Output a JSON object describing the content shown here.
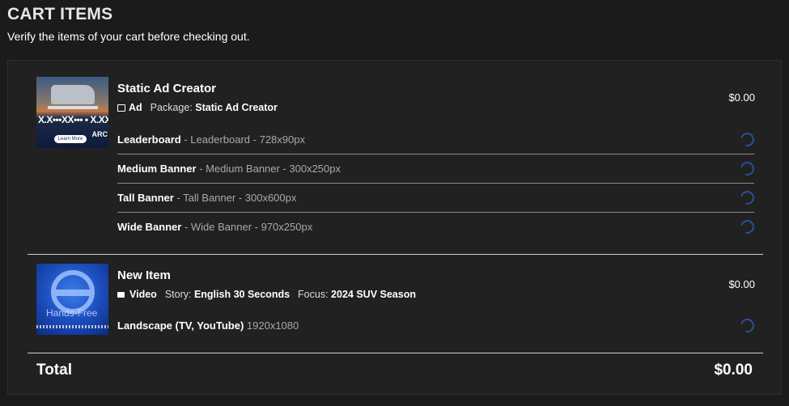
{
  "header": {
    "title": "CART ITEMS",
    "subtitle": "Verify the items of your cart before checking out."
  },
  "items": [
    {
      "icon": "static-ad-thumbnail",
      "title": "Static Ad Creator",
      "type": "Ad",
      "package_label": "Package:",
      "package_value": "Static Ad Creator",
      "price": "$0.00",
      "thumb_text": "X.X•••XX••• • X.XXX",
      "thumb_arc": "ARC",
      "thumb_button": "Learn More",
      "formats": [
        {
          "name": "Leaderboard",
          "desc": " - Leaderboard - 728x90px"
        },
        {
          "name": "Medium Banner",
          "desc": " - Medium Banner - 300x250px"
        },
        {
          "name": "Tall Banner",
          "desc": " - Tall Banner - 300x600px"
        },
        {
          "name": "Wide Banner",
          "desc": " - Wide Banner - 970x250px"
        }
      ]
    },
    {
      "icon": "video-thumbnail",
      "title": "New Item",
      "type": "Video",
      "story_label": "Story:",
      "story_value": "English 30 Seconds",
      "focus_label": "Focus:",
      "focus_value": "2024 SUV Season",
      "price": "$0.00",
      "thumb_caption": "Hands-Free",
      "formats": [
        {
          "name": "Landscape (TV, YouTube)",
          "desc": " 1920x1080"
        }
      ]
    }
  ],
  "total": {
    "label": "Total",
    "value": "$0.00"
  },
  "colors": {
    "background": "#1b1b1b",
    "panel": "#212121",
    "spinner": "#2b4f9a",
    "muted_text": "#a9a9a9"
  }
}
